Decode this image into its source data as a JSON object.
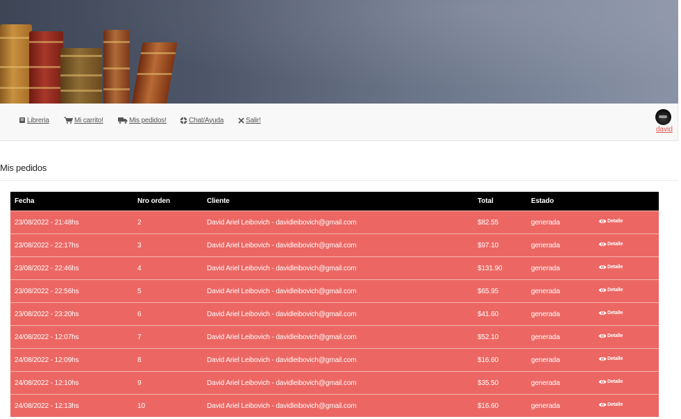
{
  "nav": {
    "items": [
      {
        "label": "Libreria",
        "icon": "book-icon"
      },
      {
        "label": "Mi carrito!",
        "icon": "cart-icon"
      },
      {
        "label": "Mis pedidos!",
        "icon": "truck-icon"
      },
      {
        "label": "Chat/Ayuda",
        "icon": "help-circle-icon"
      },
      {
        "label": "Salir!",
        "icon": "close-icon"
      }
    ],
    "user": "david"
  },
  "page_title": "Mis pedidos",
  "table": {
    "columns": [
      "Fecha",
      "Nro orden",
      "Cliente",
      "Total",
      "Estado",
      ""
    ],
    "detail_label": "Detalle",
    "rows": [
      {
        "fecha": "23/08/2022 - 21:48hs",
        "nro": "2",
        "cliente": "David Ariel Leibovich - davidleibovich@gmail.com",
        "total": "$82.55",
        "estado": "generada"
      },
      {
        "fecha": "23/08/2022 - 22:17hs",
        "nro": "3",
        "cliente": "David Ariel Leibovich - davidleibovich@gmail.com",
        "total": "$97.10",
        "estado": "generada"
      },
      {
        "fecha": "23/08/2022 - 22:46hs",
        "nro": "4",
        "cliente": "David Ariel Leibovich - davidleibovich@gmail.com",
        "total": "$131.90",
        "estado": "generada"
      },
      {
        "fecha": "23/08/2022 - 22:56hs",
        "nro": "5",
        "cliente": "David Ariel Leibovich - davidleibovich@gmail.com",
        "total": "$65.95",
        "estado": "generada"
      },
      {
        "fecha": "23/08/2022 - 23:20hs",
        "nro": "6",
        "cliente": "David Ariel Leibovich - davidleibovich@gmail.com",
        "total": "$41.60",
        "estado": "generada"
      },
      {
        "fecha": "24/08/2022 - 12:07hs",
        "nro": "7",
        "cliente": "David Ariel Leibovich - davidleibovich@gmail.com",
        "total": "$52.10",
        "estado": "generada"
      },
      {
        "fecha": "24/08/2022 - 12:09hs",
        "nro": "8",
        "cliente": "David Ariel Leibovich - davidleibovich@gmail.com",
        "total": "$16.60",
        "estado": "generada"
      },
      {
        "fecha": "24/08/2022 - 12:10hs",
        "nro": "9",
        "cliente": "David Ariel Leibovich - davidleibovich@gmail.com",
        "total": "$35.50",
        "estado": "generada"
      },
      {
        "fecha": "24/08/2022 - 12:13hs",
        "nro": "10",
        "cliente": "David Ariel Leibovich - davidleibovich@gmail.com",
        "total": "$16.60",
        "estado": "generada"
      }
    ]
  },
  "colors": {
    "header_bg": "#000000",
    "row_bg": "#ec6763",
    "user_link": "#e0564f"
  }
}
